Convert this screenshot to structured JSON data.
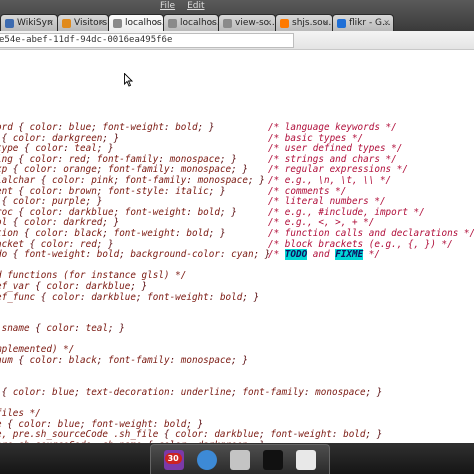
{
  "menu": {
    "file": "File",
    "edit": "Edit"
  },
  "tabs": [
    {
      "label": "WikiSyn",
      "favicon_color": "#3d6bb0"
    },
    {
      "label": "Visitors ...",
      "favicon_color": "#e08a1c"
    },
    {
      "label": "localhos...",
      "favicon_color": "#8a8a8a",
      "active": true
    },
    {
      "label": "localhos...",
      "favicon_color": "#8a8a8a"
    },
    {
      "label": "view-so...",
      "favicon_color": "#8a8a8a"
    },
    {
      "label": "shjs.sou...",
      "favicon_color": "#ff7a00"
    },
    {
      "label": "flikr - G...",
      "favicon_color": "#1f6fd6"
    }
  ],
  "url": "e54e-abef-11df-94dc-0016ea495f6e",
  "code_lines": [
    {
      "code": "ord { color: blue; font-weight: bold; }",
      "comment": "/* language keywords */"
    },
    {
      "code": " { color: darkgreen; }",
      "comment": "/* basic types */"
    },
    {
      "code": "type { color: teal; }",
      "comment": "/* user defined types */"
    },
    {
      "code": "ing { color: red; font-family: monospace; }",
      "comment": "/* strings and chars */"
    },
    {
      "code": "xp { color: orange; font-family: monospace; }",
      "comment": "/* regular expressions */"
    },
    {
      "code": "ialchar { color: pink; font-family: monospace; }",
      "comment": "/* e.g., \\n, \\t, \\\\ */"
    },
    {
      "code": "ent { color: brown; font-style: italic; }",
      "comment": "/* comments */"
    },
    {
      "code": " { color: purple; }",
      "comment": "/* literal numbers */"
    },
    {
      "code": "roc { color: darkblue; font-weight: bold; }",
      "comment": "/* e.g., #include, import */"
    },
    {
      "code": "ol { color: darkred; }",
      "comment": "/* e.g., <, >, + */"
    },
    {
      "code": "tion { color: black; font-weight: bold; }",
      "comment": "/* function calls and declarations */"
    },
    {
      "code": "acket { color: red; }",
      "comment": "/* block brackets (e.g., {, }) */"
    },
    {
      "code": "do { font-weight: bold; background-color: cyan; }",
      "comment": "/* TODO and FIXME */"
    },
    {
      "code": "",
      "comment": ""
    },
    {
      "code": "d functions (for instance glsl) */",
      "comment": ""
    },
    {
      "code": "ef_var { color: darkblue; }",
      "comment": ""
    },
    {
      "code": "ef_func { color: darkblue; font-weight: bold; }",
      "comment": ""
    },
    {
      "code": "",
      "comment": ""
    },
    {
      "code": "",
      "comment": ""
    },
    {
      "code": " sname { color: teal; }",
      "comment": ""
    },
    {
      "code": "",
      "comment": ""
    },
    {
      "code": "mplemented) */",
      "comment": ""
    },
    {
      "code": "num { color: black; font-family: monospace; }",
      "comment": ""
    },
    {
      "code": "",
      "comment": ""
    },
    {
      "code": "",
      "comment": ""
    },
    {
      "code": " { color: blue; text-decoration: underline; font-family: monospace; }",
      "comment": ""
    },
    {
      "code": "",
      "comment": ""
    },
    {
      "code": "files */",
      "comment": ""
    },
    {
      "code": "e { color: blue; font-weight: bold; }",
      "comment": ""
    },
    {
      "code": "e, pre.sh_sourceCode .sh_file { color: darkblue; font-weight: bold; }",
      "comment": ""
    },
    {
      "code": "pre.sh_sourceCode .sh_name { color: darkgreen; }",
      "comment": ""
    }
  ],
  "todo_highlight": {
    "line": 12,
    "words": [
      "TODO",
      "FIXME"
    ]
  },
  "dock_badge": "30",
  "dock_icons": [
    {
      "name": "media-icon",
      "color": "#7b3aa8"
    },
    {
      "name": "chromium-icon",
      "color": "#3d8ad6"
    },
    {
      "name": "browser-icon",
      "color": "#c4c4c4"
    },
    {
      "name": "terminal-icon",
      "color": "#111111"
    },
    {
      "name": "text-editor-icon",
      "color": "#e8e8e8"
    }
  ]
}
